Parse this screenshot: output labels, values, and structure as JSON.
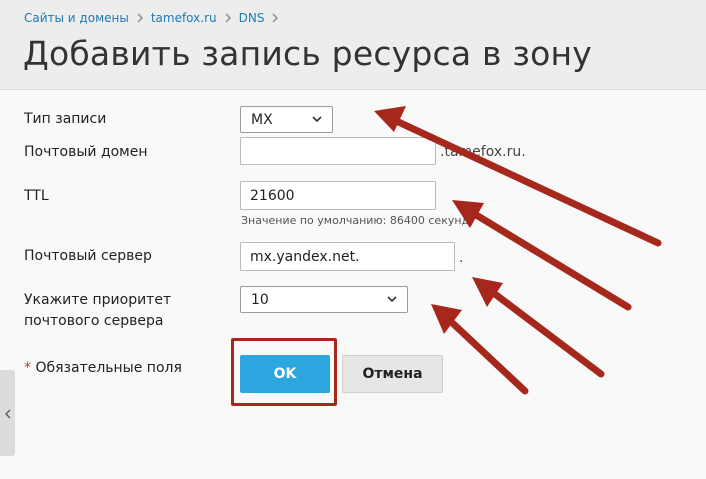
{
  "breadcrumb": {
    "items": [
      "Сайты и домены",
      "tamefox.ru",
      "DNS"
    ]
  },
  "page": {
    "title": "Добавить запись ресурса в зону"
  },
  "form": {
    "record_type": {
      "label": "Тип записи",
      "value": "MX"
    },
    "mail_domain": {
      "label": "Почтовый домен",
      "value": "",
      "suffix": ".tamefox.ru."
    },
    "ttl": {
      "label": "TTL",
      "value": "21600",
      "hint": "Значение по умолчанию: 86400 секунд"
    },
    "mail_server": {
      "label": "Почтовый сервер",
      "value": "mx.yandex.net.",
      "suffix": "."
    },
    "priority": {
      "label_line1": "Укажите приоритет",
      "label_line2": "почтового сервера",
      "value": "10"
    },
    "required_star": "*",
    "required_note": "Обязательные поля"
  },
  "buttons": {
    "ok": "OK",
    "cancel": "Отмена"
  },
  "colors": {
    "accent": "#2ba6de",
    "link": "#1e7bb3",
    "annotation": "#a6281c"
  }
}
